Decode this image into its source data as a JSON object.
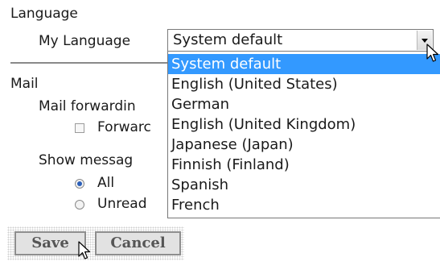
{
  "language": {
    "heading": "Language",
    "my_language_label": "My Language",
    "selected_value": "System default",
    "options": [
      "System default",
      "English (United States)",
      "German",
      "English (United Kingdom)",
      "Japanese (Japan)",
      "Finnish (Finland)",
      "Spanish",
      "French"
    ]
  },
  "mail": {
    "heading": "Mail",
    "forwarding_label": "Mail forwardin",
    "forward_checkbox_label": "Forwarc",
    "show_messages_label": "Show messag",
    "radio_all_label": "All",
    "radio_unread_label": "Unread"
  },
  "actions": {
    "save_label": "Save",
    "cancel_label": "Cancel"
  },
  "colors": {
    "selection_bg": "#3399ff",
    "text": "#1a1a1a"
  }
}
